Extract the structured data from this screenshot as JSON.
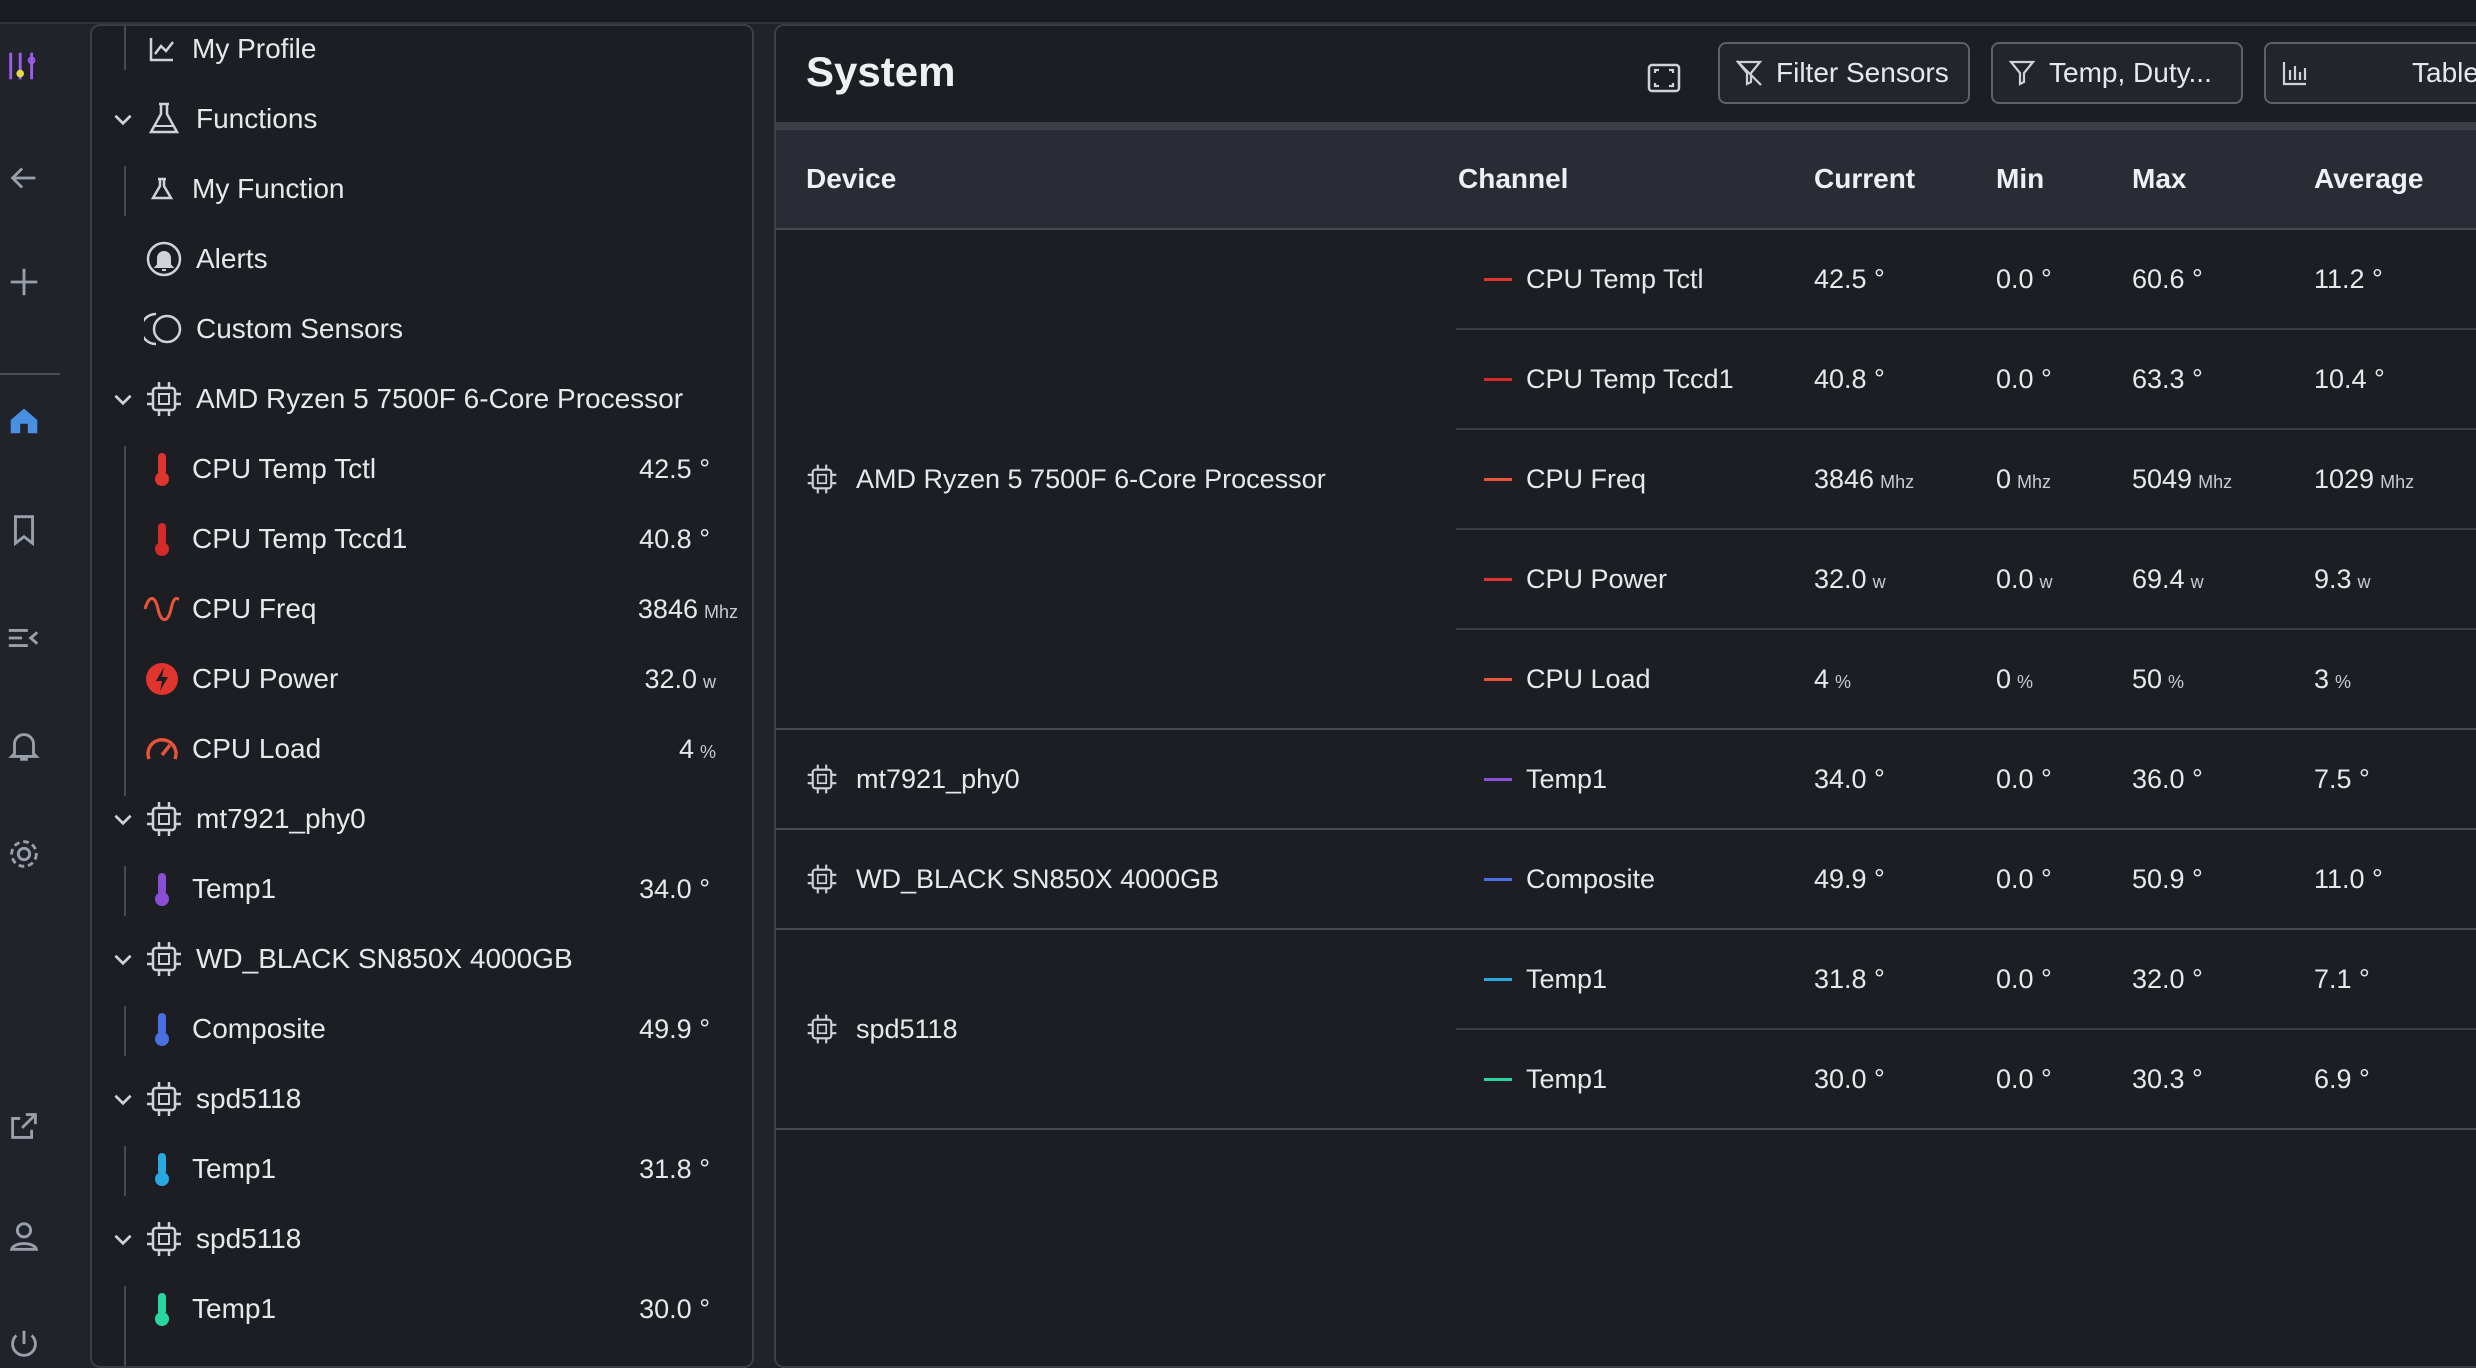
{
  "colors": {
    "bg": "#20232a",
    "panel": "#1c1e23",
    "accent_purple": "#a05cf0",
    "accent_yellow": "#e8d84a",
    "home_blue": "#4a90e2",
    "temp_red": "#e0342e",
    "freq_orange": "#e8553a",
    "temp_purple": "#8a4fd6",
    "temp_blue": "#4a6fe0",
    "temp_cyan": "#2aa8e0",
    "temp_green": "#2ad6a0"
  },
  "rail": {
    "icons": [
      "app-logo-icon",
      "back-arrow-icon",
      "add-icon",
      "home-icon",
      "bookmark-icon",
      "collapse-menu-icon",
      "bell-icon",
      "gear-icon",
      "external-link-icon",
      "user-icon",
      "power-icon"
    ]
  },
  "sidebar": {
    "items": [
      {
        "label": "My Profile",
        "icon": "line-chart-icon"
      },
      {
        "label": "Functions",
        "icon": "flask-icon"
      },
      {
        "label": "My Function",
        "icon": "flask-small-icon"
      },
      {
        "label": "Alerts",
        "icon": "alert-bell-icon"
      },
      {
        "label": "Custom Sensors",
        "icon": "custom-sensors-icon"
      },
      {
        "label": "AMD Ryzen 5 7500F 6-Core Processor",
        "icon": "chip-icon"
      },
      {
        "label": "CPU Temp Tctl",
        "value": "42.5 °",
        "unit": "",
        "icon": "thermometer-icon"
      },
      {
        "label": "CPU Temp Tccd1",
        "value": "40.8 °",
        "unit": "",
        "icon": "thermometer-icon"
      },
      {
        "label": "CPU Freq",
        "value": "3846",
        "unit": "Mhz",
        "icon": "sine-wave-icon"
      },
      {
        "label": "CPU Power",
        "value": "32.0",
        "unit": "w",
        "icon": "lightning-icon"
      },
      {
        "label": "CPU Load",
        "value": "4",
        "unit": "%",
        "icon": "gauge-icon"
      },
      {
        "label": "mt7921_phy0",
        "icon": "chip-icon"
      },
      {
        "label": "Temp1",
        "value": "34.0 °",
        "unit": "",
        "icon": "thermometer-icon"
      },
      {
        "label": "WD_BLACK SN850X 4000GB",
        "icon": "chip-icon"
      },
      {
        "label": "Composite",
        "value": "49.9 °",
        "unit": "",
        "icon": "thermometer-icon"
      },
      {
        "label": "spd5118",
        "icon": "chip-icon"
      },
      {
        "label": "Temp1",
        "value": "31.8 °",
        "unit": "",
        "icon": "thermometer-icon"
      },
      {
        "label": "spd5118",
        "icon": "chip-icon"
      },
      {
        "label": "Temp1",
        "value": "30.0 °",
        "unit": "",
        "icon": "thermometer-icon"
      }
    ]
  },
  "main": {
    "title": "System",
    "filter_sensors_label": "Filter Sensors",
    "filter_types_label": "Temp, Duty...",
    "view_label": "Table",
    "columns": {
      "device": "Device",
      "channel": "Channel",
      "current": "Current",
      "min": "Min",
      "max": "Max",
      "average": "Average"
    },
    "devices": [
      {
        "name": "AMD Ryzen 5 7500F 6-Core Processor"
      },
      {
        "name": "mt7921_phy0"
      },
      {
        "name": "WD_BLACK SN850X 4000GB"
      },
      {
        "name": "spd5118"
      }
    ],
    "rows": [
      {
        "channel": "CPU Temp Tctl",
        "color": "#e0342e",
        "current": "42.5 °",
        "current_unit": "",
        "min": "0.0 °",
        "min_unit": "",
        "max": "60.6 °",
        "max_unit": "",
        "avg": "11.2 °",
        "avg_unit": ""
      },
      {
        "channel": "CPU Temp Tccd1",
        "color": "#d42a2a",
        "current": "40.8 °",
        "current_unit": "",
        "min": "0.0 °",
        "min_unit": "",
        "max": "63.3 °",
        "max_unit": "",
        "avg": "10.4 °",
        "avg_unit": ""
      },
      {
        "channel": "CPU Freq",
        "color": "#e8553a",
        "current": "3846",
        "current_unit": "Mhz",
        "min": "0",
        "min_unit": "Mhz",
        "max": "5049",
        "max_unit": "Mhz",
        "avg": "1029",
        "avg_unit": "Mhz"
      },
      {
        "channel": "CPU Power",
        "color": "#e0342e",
        "current": "32.0",
        "current_unit": "w",
        "min": "0.0",
        "min_unit": "w",
        "max": "69.4",
        "max_unit": "w",
        "avg": "9.3",
        "avg_unit": "w"
      },
      {
        "channel": "CPU Load",
        "color": "#e8553a",
        "current": "4",
        "current_unit": "%",
        "min": "0",
        "min_unit": "%",
        "max": "50",
        "max_unit": "%",
        "avg": "3",
        "avg_unit": "%"
      },
      {
        "channel": "Temp1",
        "color": "#8a4fd6",
        "current": "34.0 °",
        "current_unit": "",
        "min": "0.0 °",
        "min_unit": "",
        "max": "36.0 °",
        "max_unit": "",
        "avg": "7.5 °",
        "avg_unit": ""
      },
      {
        "channel": "Composite",
        "color": "#4a6fe0",
        "current": "49.9 °",
        "current_unit": "",
        "min": "0.0 °",
        "min_unit": "",
        "max": "50.9 °",
        "max_unit": "",
        "avg": "11.0 °",
        "avg_unit": ""
      },
      {
        "channel": "Temp1",
        "color": "#2aa8e0",
        "current": "31.8 °",
        "current_unit": "",
        "min": "0.0 °",
        "min_unit": "",
        "max": "32.0 °",
        "max_unit": "",
        "avg": "7.1 °",
        "avg_unit": ""
      },
      {
        "channel": "Temp1",
        "color": "#2ad6a0",
        "current": "30.0 °",
        "current_unit": "",
        "min": "0.0 °",
        "min_unit": "",
        "max": "30.3 °",
        "max_unit": "",
        "avg": "6.9 °",
        "avg_unit": ""
      }
    ]
  }
}
